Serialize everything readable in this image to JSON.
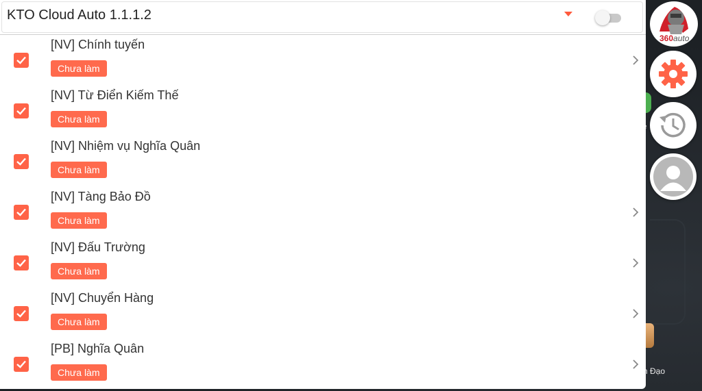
{
  "header": {
    "title": "KTO Cloud Auto 1.1.1.2",
    "toggle_on": false
  },
  "tasks": [
    {
      "title": "[NV] Chính tuyến",
      "status": "Chưa làm",
      "checked": true,
      "has_arrow": true
    },
    {
      "title": "[NV] Từ Điển Kiếm Thế",
      "status": "Chưa làm",
      "checked": true,
      "has_arrow": false
    },
    {
      "title": "[NV] Nhiệm vụ Nghĩa Quân",
      "status": "Chưa làm",
      "checked": true,
      "has_arrow": false
    },
    {
      "title": "[NV] Tàng Bảo Đồ",
      "status": "Chưa làm",
      "checked": true,
      "has_arrow": true
    },
    {
      "title": "[NV] Đấu Trường",
      "status": "Chưa làm",
      "checked": true,
      "has_arrow": true
    },
    {
      "title": "[NV] Chuyển Hàng",
      "status": "Chưa làm",
      "checked": true,
      "has_arrow": true
    },
    {
      "title": "[PB] Nghĩa Quân",
      "status": "Chưa làm",
      "checked": true,
      "has_arrow": true
    }
  ],
  "side_buttons": {
    "logo_text": "360",
    "logo_sub": "auto",
    "icons": [
      "logo-icon",
      "gear-icon",
      "history-icon",
      "user-icon"
    ]
  },
  "background": {
    "partial_label": "n Đạo",
    "partial_small": "e"
  },
  "colors": {
    "accent": "#ff6347",
    "badge": "#ff6a4d"
  }
}
